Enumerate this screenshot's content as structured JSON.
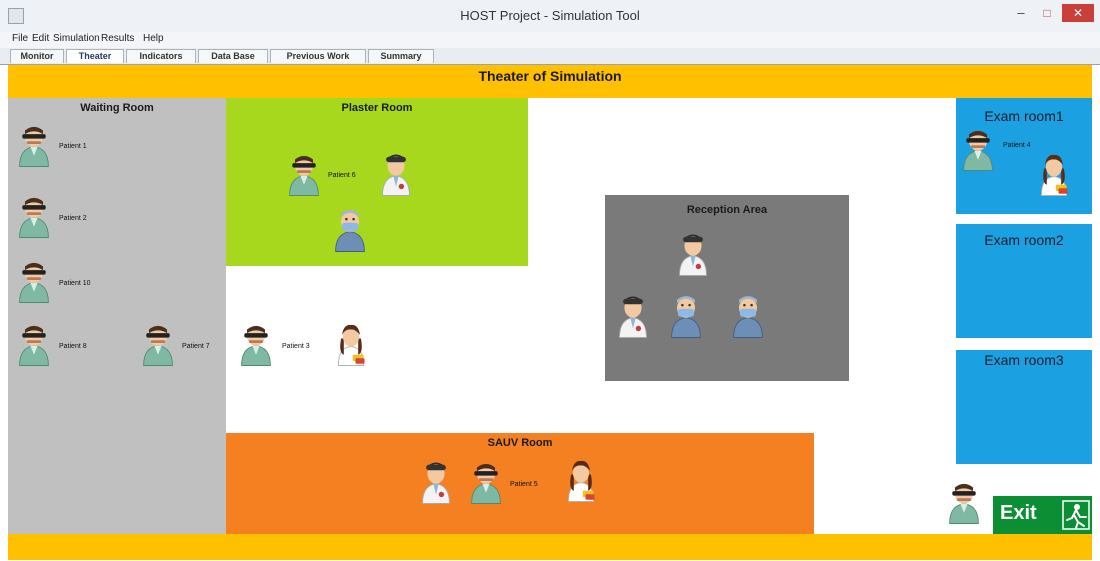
{
  "window": {
    "title": "HOST Project - Simulation Tool",
    "minimize": "–",
    "maximize": "□",
    "close": "✕"
  },
  "menu": [
    "File",
    "Edit",
    "Simulation",
    "Results",
    "Help"
  ],
  "tabs": [
    {
      "label": "Monitor",
      "active": false
    },
    {
      "label": "Theater",
      "active": true
    },
    {
      "label": "Indicators",
      "active": false
    },
    {
      "label": "Data Base",
      "active": false
    },
    {
      "label": "Previous Work",
      "active": false
    },
    {
      "label": "Summary",
      "active": false
    }
  ],
  "theater": {
    "title": "Theater of Simulation"
  },
  "rooms": {
    "waiting": {
      "title": "Waiting Room",
      "color": "#c0c0c0"
    },
    "plaster": {
      "title": "Plaster Room",
      "color": "#a8d81e"
    },
    "reception": {
      "title": "Reception Area",
      "color": "#7a7a7a"
    },
    "sauv": {
      "title": "SAUV Room",
      "color": "#f58021"
    },
    "exam1": {
      "title": "Exam room1",
      "color": "#1ba1e2"
    },
    "exam2": {
      "title": "Exam room2",
      "color": "#1ba1e2"
    },
    "exam3": {
      "title": "Exam room3",
      "color": "#1ba1e2"
    }
  },
  "patients": {
    "p1": "Patient 1",
    "p2": "Patient 2",
    "p10": "Patient 10",
    "p8": "Patient 8",
    "p7": "Patient 7",
    "p3": "Patient 3",
    "p6": "Patient 6",
    "p4": "Patient 4",
    "p5": "Patient 5"
  },
  "exit": {
    "label": "Exit"
  },
  "colors": {
    "accent": "#ffc000",
    "exit": "#0c8f34",
    "patient_gown": "#7fb9a4",
    "doctor_coat": "#f3f3f3",
    "nurse_hair": "#5a2a1a"
  },
  "icons": [
    "patient-icon",
    "doctor-icon",
    "surgeon-icon",
    "nurse-icon",
    "exit-icon"
  ]
}
